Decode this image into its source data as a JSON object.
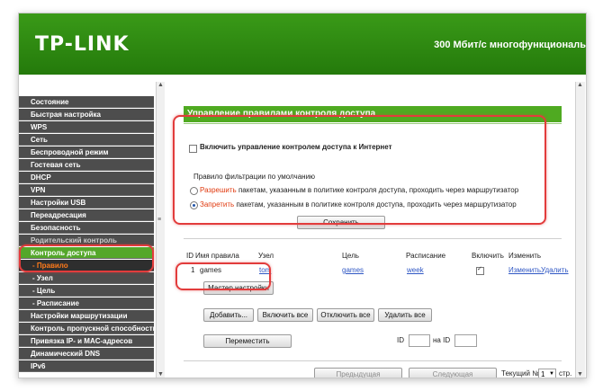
{
  "header": {
    "logo": "TP-LINK",
    "model": "300 Мбит/с многофункциональ"
  },
  "sidebar": {
    "items": [
      {
        "label": "Состояние"
      },
      {
        "label": "Быстрая настройка"
      },
      {
        "label": "WPS"
      },
      {
        "label": "Сеть"
      },
      {
        "label": "Беспроводной режим"
      },
      {
        "label": "Гостевая сеть"
      },
      {
        "label": "DHCP"
      },
      {
        "label": "VPN"
      },
      {
        "label": "Настройки USB"
      },
      {
        "label": "Переадресация"
      },
      {
        "label": "Безопасность"
      },
      {
        "label": "Родительский контроль"
      },
      {
        "label": "Контроль доступа"
      },
      {
        "label": "- Правило"
      },
      {
        "label": "- Узел"
      },
      {
        "label": "- Цель"
      },
      {
        "label": "- Расписание"
      },
      {
        "label": "Настройки маршрутизации"
      },
      {
        "label": "Контроль пропускной способности"
      },
      {
        "label": "Привязка IP- и MAC-адресов"
      },
      {
        "label": "Динамический DNS"
      },
      {
        "label": "IPv6"
      }
    ]
  },
  "main": {
    "title": "Управление правилами контроля доступа",
    "enable_label": "Включить управление контролем доступа к Интернет",
    "default_rule_label": "Правило фильтрации по умолчанию",
    "allow_word": "Разрешить",
    "allow_rest": " пакетам, указанным в политике контроля доступа, проходить через маршрутизатор",
    "deny_word": "Запретить",
    "deny_rest": " пакетам, указанным в политике контроля доступа, проходить через маршрутизатор",
    "save_button": "Сохранить",
    "table": {
      "headers": [
        "ID",
        "Имя правила",
        "Узел",
        "Цель",
        "Расписание",
        "Включить",
        "Изменить"
      ],
      "row": {
        "id": "1",
        "name": "games",
        "host": "tom",
        "target": "games",
        "schedule": "week",
        "edit": "Изменить",
        "delete": "Удалить"
      }
    },
    "wizard_button": "Мастер настройки",
    "add_button": "Добавить...",
    "enable_all_button": "Включить все",
    "disable_all_button": "Отключить все",
    "delete_all_button": "Удалить все",
    "move_button": "Переместить",
    "id_label": "ID",
    "to_id_label": "на ID",
    "prev_button": "Предыдущая",
    "next_button": "Следующая",
    "current_page_label": "Текущий №",
    "page_value": "1",
    "page_suffix": "стр."
  },
  "colors": {
    "brand_green": "#3a9a18",
    "sidebar_bg": "#4d4d4d",
    "highlight": "#e23c3c",
    "accent_orange": "#e0390e"
  }
}
